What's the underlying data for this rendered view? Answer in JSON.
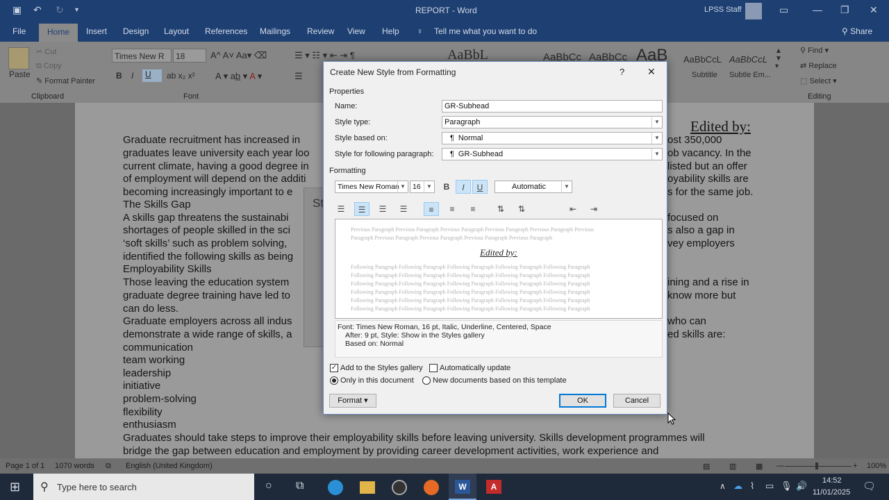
{
  "window": {
    "title": "REPORT - Word",
    "user": "LPSS Staff"
  },
  "tabs": [
    "File",
    "Home",
    "Insert",
    "Design",
    "Layout",
    "References",
    "Mailings",
    "Review",
    "View",
    "Help",
    "Tell me what you want to do",
    "Share"
  ],
  "ribbon": {
    "clipboard": {
      "paste": "Paste",
      "cut": "Cut",
      "copy": "Copy",
      "painter": "Format Painter",
      "group": "Clipboard"
    },
    "font": {
      "name": "Times New R",
      "size": "18",
      "group": "Font"
    },
    "styles": {
      "items": [
        "AaBbL",
        "AaBbCc",
        "AaBbCc",
        "AaB",
        "AaBbCcL",
        "AaBbCcL"
      ],
      "subtitle": "Subtitle",
      "subtle": "Subtle Em..."
    },
    "editing": {
      "find": "Find",
      "replace": "Replace",
      "select": "Select",
      "group": "Editing"
    }
  },
  "document": {
    "header_right": "Edited by:",
    "lines": [
      "Graduate recruitment has increased in",
      "graduates leave university each year loo",
      "current climate, having a good degree in",
      "of employment will depend on the additi",
      "becoming increasingly important to e",
      "The Skills Gap",
      "A skills gap threatens the sustainabi",
      "shortages of people skilled in the sci",
      "‘soft skills’ such as problem solving,",
      "identified the following skills as being",
      "Employability Skills",
      "Those leaving the education system",
      "graduate degree training have led to",
      "can do less.",
      "Graduate employers across all indus",
      "demonstrate a wide range of skills, a",
      "communication",
      "team working",
      "leadership",
      "initiative",
      "problem-solving",
      "flexibility",
      "enthusiasm",
      "Graduates should take steps to improve their employability skills before leaving university. Skills development programmes will",
      "bridge the gap between education and employment by providing career development activities, work experience and"
    ],
    "right_lines": [
      "ost 350,000",
      "ob vacancy. In the",
      "listed but an offer",
      "oyability skills are",
      "s for the same job.",
      "",
      "focused on",
      "s also a gap in",
      "vey employers",
      "",
      "",
      "ining and a rise in",
      "know more but",
      "",
      "who can",
      "ed skills are:"
    ]
  },
  "behind_dialog": {
    "letter": "St"
  },
  "dialog": {
    "title": "Create New Style from Formatting",
    "help": "?",
    "close": "✕",
    "properties": "Properties",
    "name_label": "Name:",
    "name_value": "GR-Subhead",
    "type_label": "Style type:",
    "type_value": "Paragraph",
    "based_label": "Style based on:",
    "based_value": "Normal",
    "following_label": "Style for following paragraph:",
    "following_value": "GR-Subhead",
    "formatting": "Formatting",
    "font": "Times New Roman",
    "size": "16",
    "bold": "B",
    "italic": "I",
    "underline": "U",
    "color": "Automatic",
    "preview_prev": "Previous Paragraph Previous Paragraph Previous Paragraph Previous Paragraph Previous Paragraph Previous",
    "preview_prev2": "Paragraph Previous Paragraph Previous Paragraph Previous Paragraph Previous Paragraph",
    "preview_sample": "Edited by:",
    "preview_follow": "Following Paragraph Following Paragraph Following Paragraph Following Paragraph Following Paragraph",
    "desc1": "Font: Times New Roman, 16 pt, Italic, Underline, Centered, Space",
    "desc2": "After:  9 pt, Style: Show in the Styles gallery",
    "desc3": "Based on: Normal",
    "add_gallery": "Add to the Styles gallery",
    "auto_update": "Automatically update",
    "only_doc": "Only in this document",
    "new_docs": "New documents based on this template",
    "format": "Format",
    "ok": "OK",
    "cancel": "Cancel"
  },
  "status": {
    "page": "Page 1 of 1",
    "words": "1070 words",
    "lang": "English (United Kingdom)",
    "zoom": "100%"
  },
  "taskbar": {
    "search": "Type here to search",
    "time": "14:52",
    "date": "11/01/2025"
  }
}
